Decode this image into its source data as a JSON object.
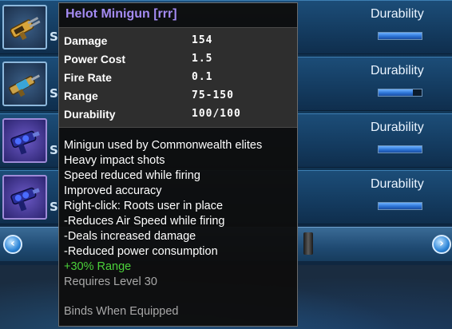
{
  "inventory": {
    "rows": [
      {
        "item_icon": "minigun-icon",
        "frame": "blue",
        "mark": "S",
        "durability_label": "Durability",
        "durability": 1.0
      },
      {
        "item_icon": "rifle-icon",
        "frame": "blue",
        "mark": "S",
        "durability_label": "Durability",
        "durability": 0.8
      },
      {
        "item_icon": "pistol-icon",
        "frame": "purple",
        "mark": "S",
        "durability_label": "Durability",
        "durability": 1.0
      },
      {
        "item_icon": "pistol-icon",
        "frame": "purple",
        "mark": "S",
        "durability_label": "Durability",
        "durability": 1.0
      }
    ],
    "nav": {
      "prev_icon": "chevron-left-icon",
      "next_icon": "chevron-right-icon",
      "prev_glyph": "‹",
      "next_glyph": "›"
    }
  },
  "tooltip": {
    "title": "Helot Minigun [rrr]",
    "title_color": "#a48bf2",
    "stats": [
      {
        "label": "Damage",
        "value": "154"
      },
      {
        "label": "Power Cost",
        "value": "1.5"
      },
      {
        "label": "Fire Rate",
        "value": "0.1"
      },
      {
        "label": "Range",
        "value": "75-150"
      },
      {
        "label": "Durability",
        "value": "100/100"
      }
    ],
    "description": [
      "Minigun used by Commonwealth elites",
      "Heavy impact shots",
      "Speed reduced while firing",
      "Improved accuracy",
      "Right-click: Roots user in place",
      " -Reduces Air Speed while firing",
      " -Deals increased damage",
      " -Reduced power consumption"
    ],
    "bonus": "+30% Range",
    "bonus_color": "#4bd13a",
    "requirement": "Requires Level 30",
    "binding": "Binds When Equipped"
  }
}
